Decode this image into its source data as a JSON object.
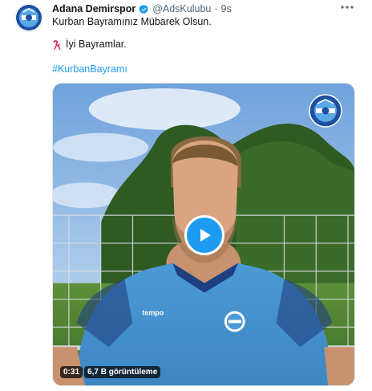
{
  "tweet": {
    "author": {
      "display_name": "Adana Demirspor",
      "handle": "@AdsKulubu",
      "separator": "·",
      "time": "9s",
      "avatar_icon": "club-logo-icon",
      "verified_icon": "verified-badge-icon"
    },
    "more_icon": "more-options-icon",
    "text_line1": "Kurban Bayramınız Mübarek Olsun.",
    "text_line2": "İyi Bayramlar.",
    "emoji_icon": "ribbon-candy-emoji-icon",
    "hashtag": "#KurbanBayramı",
    "video": {
      "duration": "0:31",
      "views": "6,7 B görüntüleme",
      "play_icon": "play-icon",
      "watermark_icon": "club-logo-watermark-icon"
    }
  },
  "colors": {
    "accent": "#1d9bf0",
    "text_primary": "#0f1419",
    "text_secondary": "#536471",
    "club_blue": "#1f4fa0",
    "jersey": "#4f9fd8"
  }
}
